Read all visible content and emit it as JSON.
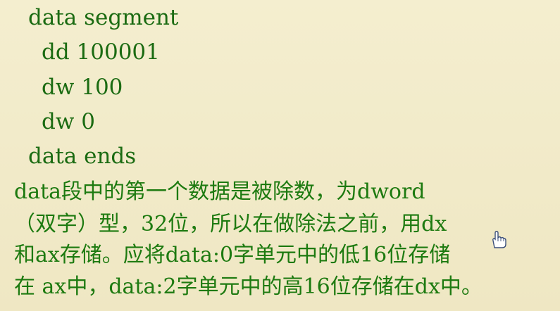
{
  "code": {
    "line1": "data segment",
    "line2": "dd 100001",
    "line3": "dw 100",
    "line4": "dw 0",
    "line5": "data ends"
  },
  "paragraph": {
    "line1": "data段中的第一个数据是被除数，为dword",
    "line2": "（双字）型，32位，所以在做除法之前，用dx",
    "line3": "和ax存储。应将data:0字单元中的低16位存储",
    "line4": "在 ax中，data:2字单元中的高16位存储在dx中。"
  },
  "colors": {
    "background": "#f2ebc9",
    "text": "#1b6b12"
  },
  "icons": {
    "cursor": "hand-pointer-icon"
  }
}
